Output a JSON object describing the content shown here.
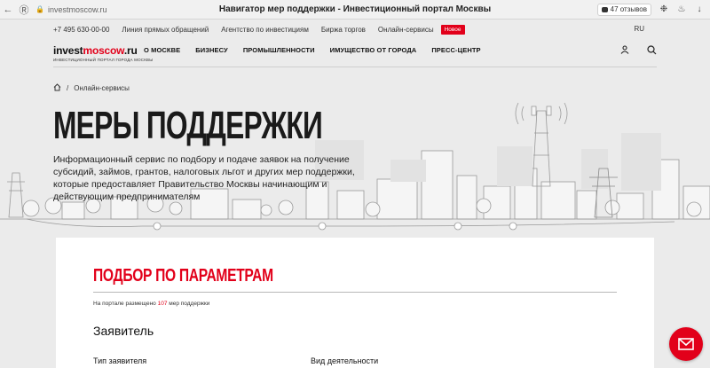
{
  "browser": {
    "url": "investmoscow.ru",
    "tab_title": "Навигатор мер поддержки - Инвестиционный портал Москвы",
    "reviews": "47 отзывов"
  },
  "topbar": {
    "phone": "+7 495 630-00-00",
    "links": [
      "Линия прямых обращений",
      "Агентство по инвестициям",
      "Биржа торгов",
      "Онлайн-сервисы"
    ],
    "badge": "Новое",
    "lang": "RU"
  },
  "logo": {
    "main": "invest",
    "accent": "moscow",
    "suffix": ".ru",
    "subtitle": "ИНВЕСТИЦИОННЫЙ ПОРТАЛ ГОРОДА МОСКВЫ"
  },
  "nav": {
    "items": [
      "О Москве",
      "Бизнесу",
      "Промышленности",
      "Имущество от города",
      "Пресс-центр"
    ]
  },
  "breadcrumb": {
    "separator": "/",
    "current": "Онлайн-сервисы"
  },
  "hero": {
    "title": "МЕРЫ ПОДДЕРЖКИ",
    "description": "Информационный сервис по подбору и подаче заявок на получение субсидий, займов, грантов, налоговых льгот и других мер поддержки, которые предоставляет Правительство Москвы начинающим и действующим предпринимателям"
  },
  "card": {
    "title": "ПОДБОР ПО ПАРАМЕТРАМ",
    "count_prefix": "На портале размещено",
    "count": "107",
    "count_suffix": "мер поддержки",
    "section": "Заявитель",
    "label_applicant_type": "Тип заявителя",
    "label_activity": "Вид деятельности"
  },
  "colors": {
    "accent": "#e2001a",
    "background": "#ebebeb"
  }
}
